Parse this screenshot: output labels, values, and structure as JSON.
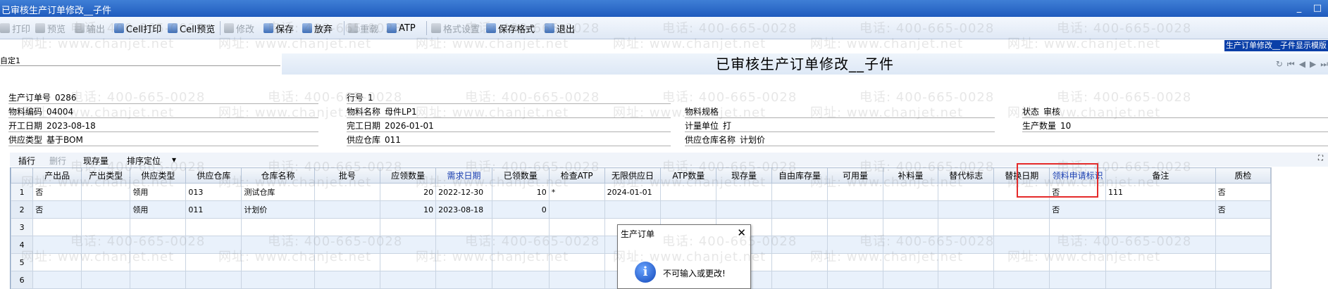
{
  "window": {
    "title": "已审核生产订单修改__子件",
    "minimize": "_",
    "maximize": "□"
  },
  "toolbar": [
    {
      "label": "打印",
      "icon": "printer-icon",
      "enabled": false
    },
    {
      "label": "预览",
      "icon": "preview-icon",
      "enabled": false
    },
    {
      "label": "输出",
      "icon": "export-icon",
      "enabled": false
    },
    {
      "label": "Cell打印",
      "icon": "cell-print-icon",
      "enabled": true
    },
    {
      "label": "Cell预览",
      "icon": "cell-preview-icon",
      "enabled": true
    },
    {
      "label": "修改",
      "icon": "edit-icon",
      "enabled": false
    },
    {
      "label": "保存",
      "icon": "save-icon",
      "enabled": true
    },
    {
      "label": "放弃",
      "icon": "discard-icon",
      "enabled": true
    },
    {
      "label": "重载",
      "icon": "reload-icon",
      "enabled": false
    },
    {
      "label": "ATP",
      "icon": "atp-icon",
      "enabled": true
    },
    {
      "label": "格式设置",
      "icon": "format-icon",
      "enabled": false
    },
    {
      "label": "保存格式",
      "icon": "save-format-icon",
      "enabled": true
    },
    {
      "label": "退出",
      "icon": "exit-icon",
      "enabled": true
    }
  ],
  "hint": "生产订单修改__子件显示模版",
  "template_field": "自定1",
  "form_title": "已审核生产订单修改__子件",
  "header": {
    "order_no_label": "生产订单号",
    "order_no": "0286",
    "line_no_label": "行号",
    "line_no": "1",
    "item_code_label": "物料编码",
    "item_code": "04004",
    "item_name_label": "物料名称",
    "item_name": "母件LP1",
    "item_spec_label": "物料规格",
    "item_spec": "",
    "status_label": "状态",
    "status": "审核",
    "start_date_label": "开工日期",
    "start_date": "2023-08-18",
    "end_date_label": "完工日期",
    "end_date": "2026-01-01",
    "unit_label": "计量单位",
    "unit": "打",
    "qty_label": "生产数量",
    "qty": "10",
    "supply_type_label": "供应类型",
    "supply_type": "基于BOM",
    "warehouse_label": "供应仓库",
    "warehouse": "011",
    "warehouse_name_label": "供应仓库名称",
    "warehouse_name": "计划价"
  },
  "gridbar": {
    "insert": "插行",
    "delete": "删行",
    "stock": "现存量",
    "sort": "排序定位",
    "sort_arrow": "▾"
  },
  "grid": {
    "columns": [
      "产出品",
      "产出类型",
      "供应类型",
      "供应仓库",
      "仓库名称",
      "批号",
      "应领数量",
      "需求日期",
      "已领数量",
      "检查ATP",
      "无限供应日",
      "ATP数量",
      "现存量",
      "自由库存量",
      "可用量",
      "补料量",
      "替代标志",
      "替换日期",
      "领料申请标识",
      "备注",
      "质检"
    ],
    "rows": [
      {
        "n": "1",
        "c": [
          "否",
          "",
          "领用",
          "013",
          "测试仓库",
          "",
          "20",
          "2022-12-30",
          "10",
          "*",
          "2024-01-01",
          "",
          "",
          "",
          "",
          "",
          "",
          "",
          "否",
          "111",
          "否"
        ]
      },
      {
        "n": "2",
        "c": [
          "否",
          "",
          "领用",
          "011",
          "计划价",
          "",
          "10",
          "2023-08-18",
          "0",
          "",
          "",
          "",
          "",
          "",
          "",
          "",
          "",
          "",
          "否",
          "",
          "否"
        ]
      },
      {
        "n": "3",
        "c": [
          "",
          "",
          "",
          "",
          "",
          "",
          "",
          "",
          "",
          "",
          "",
          "",
          "",
          "",
          "",
          "",
          "",
          "",
          "",
          "",
          ""
        ]
      },
      {
        "n": "4",
        "c": [
          "",
          "",
          "",
          "",
          "",
          "",
          "",
          "",
          "",
          "",
          "",
          "",
          "",
          "",
          "",
          "",
          "",
          "",
          "",
          "",
          ""
        ]
      },
      {
        "n": "5",
        "c": [
          "",
          "",
          "",
          "",
          "",
          "",
          "",
          "",
          "",
          "",
          "",
          "",
          "",
          "",
          "",
          "",
          "",
          "",
          "",
          "",
          ""
        ]
      },
      {
        "n": "6",
        "c": [
          "",
          "",
          "",
          "",
          "",
          "",
          "",
          "",
          "",
          "",
          "",
          "",
          "",
          "",
          "",
          "",
          "",
          "",
          "",
          "",
          ""
        ]
      }
    ]
  },
  "dialog": {
    "title": "生产订单",
    "message": "不可输入或更改!",
    "close": "✕",
    "icon": "info-icon"
  },
  "watermark": {
    "phone": "电话: 400-665-0028",
    "site": "网址: www.chanjet.net"
  }
}
